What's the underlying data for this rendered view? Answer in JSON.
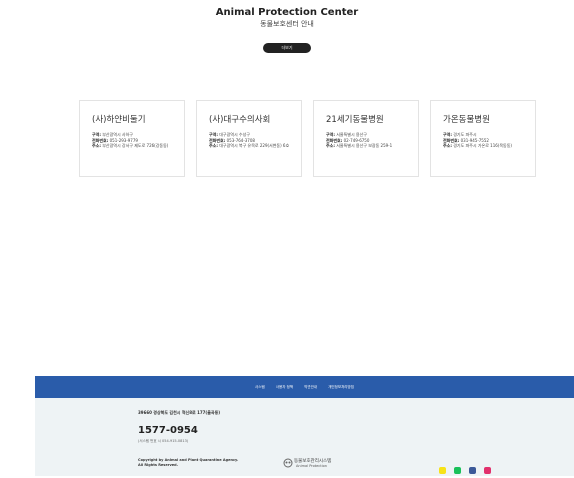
{
  "header": {
    "title": "Animal Protection Center",
    "subtitle": "동물보호센터 안내",
    "more_label": "더보기"
  },
  "cards": [
    {
      "name": "(사)하얀비둘기",
      "line1_label": "구역:",
      "line1": "부산광역시 사하구",
      "line2_label": "전화번호:",
      "line2": "051-293-9779",
      "line3_label": "주소:",
      "line3": "부산광역시 강서구 제도로 726(강동동)"
    },
    {
      "name": "(사)대구수의사회",
      "line1_label": "구역:",
      "line1": "대구광역시 수성구",
      "line2_label": "전화번호:",
      "line2": "053-764-3708",
      "line3_label": "주소:",
      "line3": "대구광역시 북구 유목로 229(서변동) 6호"
    },
    {
      "name": "21세기동물병원",
      "line1_label": "구역:",
      "line1": "서울특별시 용산구",
      "line2_label": "전화번호:",
      "line2": "02-749-6750",
      "line3_label": "주소:",
      "line3": "서울특별시 용산구 보광동 259-1"
    },
    {
      "name": "가온동물병원",
      "line1_label": "구역:",
      "line1": "경기도 파주시",
      "line2_label": "전화번호:",
      "line2": "031-945-7552",
      "line3_label": "주소:",
      "line3": "경기도 파주시 가온로 116(목동동)"
    }
  ],
  "footer": {
    "links": [
      "사스템",
      "사용자 정책",
      "약관안내",
      "개인정보처리방침"
    ],
    "address": "39660 경상북도 김천시 혁신8로 177(율곡동)",
    "phone": "1577-0954",
    "hours": "(서스템 번호 시 054-915-0813)",
    "copyright_1": "Copyright by Animal and Plant Quarantine Agency.",
    "copyright_2": "All Rights Reserved.",
    "logo_name": "동물보호관리시스템",
    "logo_eng": "Animal Protection"
  },
  "social_colors": {
    "talk": "#f7e317",
    "blog": "#19c15a",
    "facebook": "#3b5998",
    "instagram": "#e1306c"
  }
}
